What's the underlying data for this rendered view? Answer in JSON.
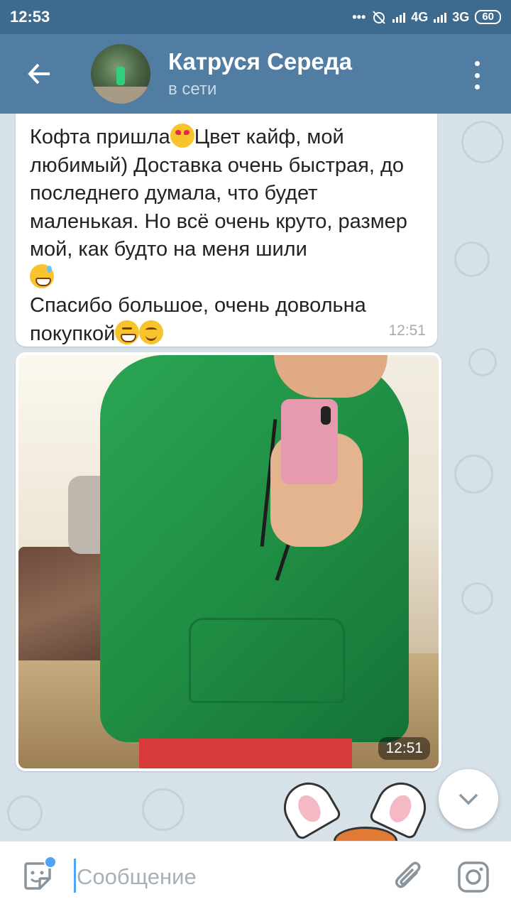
{
  "status_bar": {
    "time": "12:53",
    "network_1": "4G",
    "network_2": "3G",
    "battery": "60",
    "icons": [
      "more-dots-icon",
      "alarm-off-icon",
      "signal-icon",
      "signal-icon",
      "battery-icon"
    ]
  },
  "header": {
    "contact_name": "Катруся Середа",
    "status": "в сети",
    "back_icon": "arrow-left-icon",
    "menu_icon": "more-vertical-icon"
  },
  "messages": [
    {
      "type": "text",
      "parts": [
        {
          "text": "Кофта пришла"
        },
        {
          "emoji": "heart-eyes"
        },
        {
          "text": "Цвет кайф, мой любимый) Доставка очень быстрая, до последнего думала, что будет маленькая. Но всё очень круто, размер мой, как будто на меня шили\n"
        },
        {
          "emoji": "sweat-smile"
        },
        {
          "text": "\nСпасибо большое, очень довольна покупкой"
        },
        {
          "emoji": "grin"
        },
        {
          "emoji": "smile"
        }
      ],
      "time": "12:51"
    },
    {
      "type": "photo",
      "description_icon": "photo-green-hoodie-selfie",
      "time": "12:51"
    }
  ],
  "input": {
    "placeholder": "Сообщение",
    "value": "",
    "sticker_icon": "sticker-icon",
    "attach_icon": "paperclip-icon",
    "camera_icon": "instagram-camera-icon"
  },
  "scroll_down_icon": "chevron-down-icon",
  "colors": {
    "header": "#517da2",
    "status_bar": "#3e6a8e",
    "accent": "#4ea4f6",
    "chat_bg": "#d6e1e8"
  }
}
